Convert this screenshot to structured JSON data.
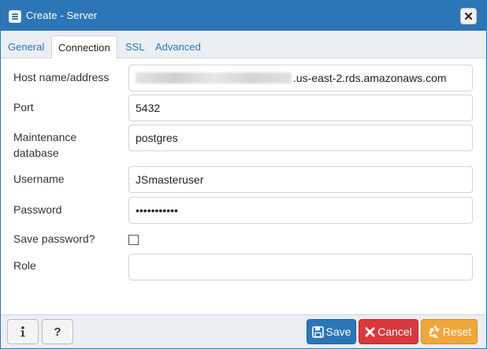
{
  "dialog": {
    "title": "Create - Server",
    "title_icon": "server-icon",
    "close_icon": "close-icon"
  },
  "tabs": [
    {
      "label": "General",
      "active": false
    },
    {
      "label": "Connection",
      "active": true
    },
    {
      "label": "SSL",
      "active": false
    },
    {
      "label": "Advanced",
      "active": false
    }
  ],
  "form": {
    "host": {
      "label": "Host name/address",
      "value_suffix": ".us-east-2.rds.amazonaws.com"
    },
    "port": {
      "label": "Port",
      "value": "5432"
    },
    "maintenance_db": {
      "label_line1": "Maintenance",
      "label_line2": "database",
      "value": "postgres"
    },
    "username": {
      "label": "Username",
      "value": "JSmasteruser"
    },
    "password": {
      "label": "Password",
      "value": "•••••••••••"
    },
    "save_password": {
      "label": "Save password?",
      "checked": false
    },
    "role": {
      "label": "Role",
      "value": ""
    }
  },
  "footer": {
    "info_icon": "info-icon",
    "help_label": "?",
    "save_label": "Save",
    "cancel_label": "Cancel",
    "reset_label": "Reset"
  },
  "colors": {
    "primary": "#2c76b8",
    "danger": "#d9393c",
    "warning": "#f0a73a"
  }
}
